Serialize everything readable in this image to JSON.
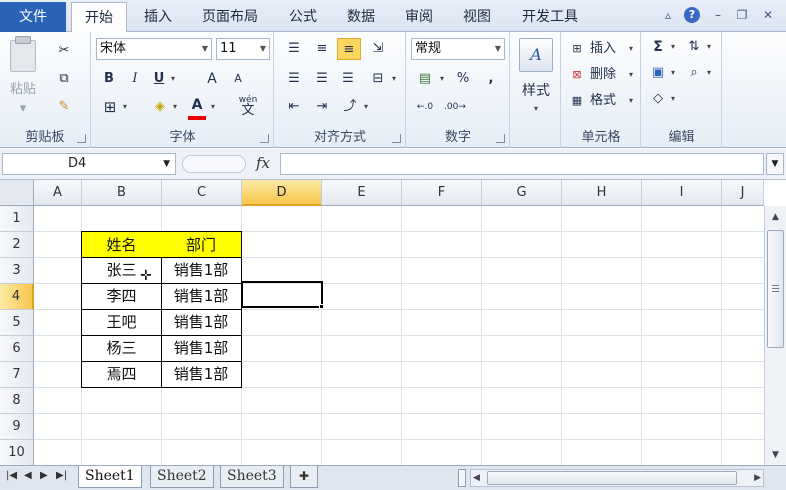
{
  "tabs": {
    "file": "文件",
    "items": [
      "开始",
      "插入",
      "页面布局",
      "公式",
      "数据",
      "审阅",
      "视图",
      "开发工具"
    ]
  },
  "window": {
    "help": "?"
  },
  "ribbon": {
    "clipboard": {
      "label": "剪贴板",
      "paste": "粘贴"
    },
    "font": {
      "label": "字体",
      "font_name": "宋体",
      "font_size": "11",
      "bold": "B",
      "italic": "I",
      "underline": "U",
      "grow": "A",
      "shrink": "A",
      "color_letter": "A",
      "phonetic": "wén"
    },
    "alignment": {
      "label": "对齐方式"
    },
    "number": {
      "label": "数字",
      "format": "常规",
      "percent": "%",
      "comma": ","
    },
    "styles": {
      "label": "样式"
    },
    "cells": {
      "label": "单元格",
      "insert": "插入",
      "delete": "删除",
      "format": "格式"
    },
    "editing": {
      "label": "编辑",
      "sum": "Σ"
    }
  },
  "formula_bar": {
    "name_box": "D4",
    "fx": "fx",
    "content": ""
  },
  "grid": {
    "columns": [
      "A",
      "B",
      "C",
      "D",
      "E",
      "F",
      "G",
      "H",
      "I",
      "J"
    ],
    "rows": [
      "1",
      "2",
      "3",
      "4",
      "5",
      "6",
      "7",
      "8",
      "9",
      "10"
    ],
    "active_cell": "D4",
    "table": {
      "headers": [
        "姓名",
        "部门"
      ],
      "rows": [
        [
          "张三",
          "销售1部"
        ],
        [
          "李四",
          "销售1部"
        ],
        [
          "王吧",
          "销售1部"
        ],
        [
          "杨三",
          "销售1部"
        ],
        [
          "焉四",
          "销售1部"
        ]
      ]
    }
  },
  "sheets": [
    "Sheet1",
    "Sheet2",
    "Sheet3"
  ],
  "colors": {
    "header_fill": "#ffff00",
    "active_header": "#f8c64d",
    "file_tab": "#2a62b8"
  }
}
